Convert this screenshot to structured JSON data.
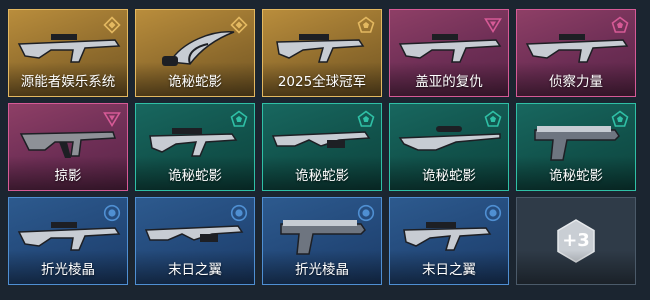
{
  "skins": [
    {
      "name": "源能者娱乐系统",
      "tier": "gold",
      "icon": "diamond-tier-icon",
      "gun": "rifle"
    },
    {
      "name": "诡秘蛇影",
      "tier": "gold",
      "icon": "diamond-tier-icon",
      "gun": "karambit"
    },
    {
      "name": "2025全球冠军",
      "tier": "gold",
      "icon": "pentagon-tier-icon",
      "gun": "smg"
    },
    {
      "name": "盖亚的复仇",
      "tier": "pink",
      "icon": "triangle-tier-icon",
      "gun": "rifle"
    },
    {
      "name": "侦察力量",
      "tier": "pink",
      "icon": "pentagon-tier-icon",
      "gun": "rifle"
    },
    {
      "name": "掠影",
      "tier": "pink",
      "icon": "triangle-tier-icon",
      "gun": "ak"
    },
    {
      "name": "诡秘蛇影",
      "tier": "teal",
      "icon": "pentagon-tier-icon",
      "gun": "smg"
    },
    {
      "name": "诡秘蛇影",
      "tier": "teal",
      "icon": "pentagon-tier-icon",
      "gun": "shotgun"
    },
    {
      "name": "诡秘蛇影",
      "tier": "teal",
      "icon": "pentagon-tier-icon",
      "gun": "sniper"
    },
    {
      "name": "诡秘蛇影",
      "tier": "teal",
      "icon": "pentagon-tier-icon",
      "gun": "pistol"
    },
    {
      "name": "折光棱晶",
      "tier": "blue",
      "icon": "circle-tier-icon",
      "gun": "rifle"
    },
    {
      "name": "末日之翼",
      "tier": "blue",
      "icon": "circle-tier-icon",
      "gun": "shotgun"
    },
    {
      "name": "折光棱晶",
      "tier": "blue",
      "icon": "circle-tier-icon",
      "gun": "pistol"
    },
    {
      "name": "末日之翼",
      "tier": "blue",
      "icon": "circle-tier-icon",
      "gun": "smg"
    }
  ],
  "more": {
    "label": "+3"
  },
  "colors": {
    "gold": "#e3b860",
    "pink": "#d65a96",
    "teal": "#2fc0a6",
    "blue": "#4f8fd2"
  }
}
